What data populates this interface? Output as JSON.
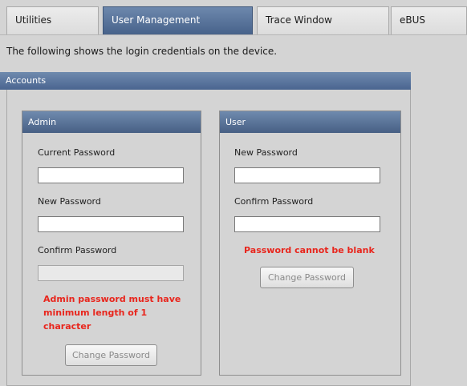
{
  "tabs": [
    {
      "label": "Utilities",
      "active": false
    },
    {
      "label": "User Management",
      "active": true
    },
    {
      "label": "Trace Window",
      "active": false
    },
    {
      "label": "eBUS",
      "active": false
    }
  ],
  "description": "The following shows the login credentials on the device.",
  "accounts": {
    "title": "Accounts",
    "admin": {
      "title": "Admin",
      "current_password_label": "Current Password",
      "current_password_value": "",
      "new_password_label": "New Password",
      "new_password_value": "",
      "confirm_password_label": "Confirm Password",
      "confirm_password_value": "",
      "error": "Admin password must have minimum length of 1 character",
      "button_label": "Change Password"
    },
    "user": {
      "title": "User",
      "new_password_label": "New Password",
      "new_password_value": "",
      "confirm_password_label": "Confirm Password",
      "confirm_password_value": "",
      "error": "Password cannot be blank",
      "button_label": "Change Password"
    }
  },
  "colors": {
    "active_tab": "#4f6a92",
    "panel_header": "#55709a",
    "error_text": "#e8261d"
  }
}
